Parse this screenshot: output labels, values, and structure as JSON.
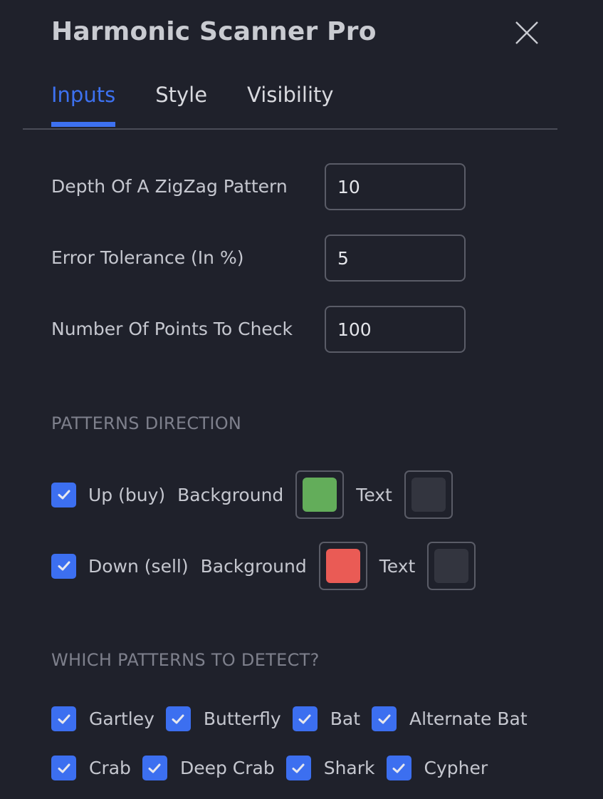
{
  "header": {
    "title": "Harmonic Scanner Pro",
    "close_icon": "close-icon"
  },
  "tabs": [
    {
      "label": "Inputs",
      "active": true
    },
    {
      "label": "Style",
      "active": false
    },
    {
      "label": "Visibility",
      "active": false
    }
  ],
  "inputs": [
    {
      "label": "Depth Of A ZigZag Pattern",
      "value": "10"
    },
    {
      "label": "Error Tolerance (In %)",
      "value": "5"
    },
    {
      "label": "Number Of Points To Check",
      "value": "100"
    }
  ],
  "direction": {
    "section_title": "PATTERNS DIRECTION",
    "rows": [
      {
        "label": "Up (buy)",
        "checked": true,
        "background_label": "Background",
        "background_color": "#63ad5a",
        "text_label": "Text",
        "text_color": "#33353f"
      },
      {
        "label": "Down (sell)",
        "checked": true,
        "background_label": "Background",
        "background_color": "#ea5b55",
        "text_label": "Text",
        "text_color": "#33353f"
      }
    ]
  },
  "patterns": {
    "section_title": "WHICH PATTERNS TO DETECT?",
    "items": [
      {
        "label": "Gartley",
        "checked": true
      },
      {
        "label": "Butterfly",
        "checked": true
      },
      {
        "label": "Bat",
        "checked": true
      },
      {
        "label": "Alternate Bat",
        "checked": true
      },
      {
        "label": "Crab",
        "checked": true
      },
      {
        "label": "Deep Crab",
        "checked": true
      },
      {
        "label": "Shark",
        "checked": true
      },
      {
        "label": "Cypher",
        "checked": true
      }
    ]
  },
  "colors": {
    "accent": "#3d71f0",
    "background": "#1f212b"
  }
}
